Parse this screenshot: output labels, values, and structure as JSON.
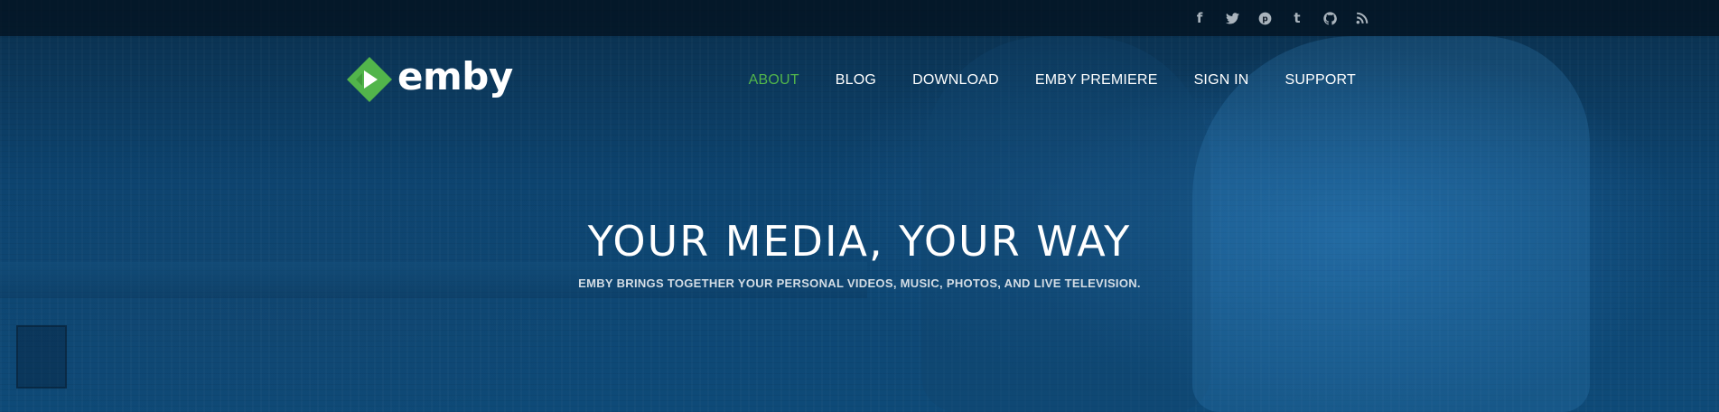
{
  "social": {
    "items": [
      {
        "icon": "facebook-icon",
        "glyph": "f"
      },
      {
        "icon": "twitter-icon",
        "glyph": ""
      },
      {
        "icon": "pinterest-icon",
        "glyph": "p"
      },
      {
        "icon": "tumblr-icon",
        "glyph": "t"
      },
      {
        "icon": "github-icon",
        "glyph": ""
      },
      {
        "icon": "rss-icon",
        "glyph": ""
      }
    ]
  },
  "brand": {
    "logo_text": "emby",
    "accent_color": "#52b54b"
  },
  "nav": {
    "items": [
      {
        "label": "ABOUT",
        "active": true
      },
      {
        "label": "BLOG",
        "active": false
      },
      {
        "label": "DOWNLOAD",
        "active": false
      },
      {
        "label": "EMBY PREMIERE",
        "active": false
      },
      {
        "label": "SIGN IN",
        "active": false
      },
      {
        "label": "SUPPORT",
        "active": false
      }
    ]
  },
  "hero": {
    "headline": "YOUR MEDIA, YOUR WAY",
    "subheadline": "EMBY BRINGS TOGETHER YOUR PERSONAL VIDEOS, MUSIC, PHOTOS, AND LIVE TELEVISION."
  }
}
